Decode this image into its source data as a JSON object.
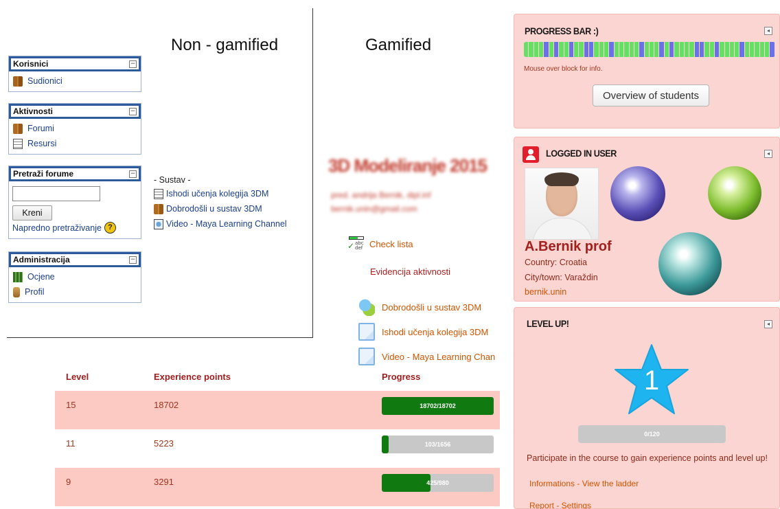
{
  "headings": {
    "non_gamified": "Non - gamified",
    "gamified": "Gamified"
  },
  "nongamified": {
    "blocks": [
      {
        "title": "Korisnici",
        "items": [
          {
            "label": "Sudionici",
            "icon": "people-icon"
          }
        ]
      },
      {
        "title": "Aktivnosti",
        "items": [
          {
            "label": "Forumi",
            "icon": "forum-icon"
          },
          {
            "label": "Resursi",
            "icon": "document-icon"
          }
        ]
      },
      {
        "title": "Pretraži forume",
        "search_value": "",
        "button_label": "Kreni",
        "advanced_link": "Napredno pretraživanje"
      },
      {
        "title": "Administracija",
        "items": [
          {
            "label": "Ocjene",
            "icon": "grades-icon"
          },
          {
            "label": "Profil",
            "icon": "profile-icon"
          }
        ]
      }
    ],
    "toggle_symbol": "−",
    "help_symbol": "?",
    "sustav": {
      "title": "- Sustav -",
      "items": [
        {
          "label": "Ishodi učenja kolegija 3DM",
          "icon": "document-icon"
        },
        {
          "label": "Dobrodošli u sustav 3DM",
          "icon": "forum-icon"
        },
        {
          "label": "Video - Maya Learning Channel",
          "icon": "video-icon"
        }
      ]
    }
  },
  "gamified": {
    "course_title": "3D Modeliranje 2015",
    "course_teacher": "pred. andrija Bernik, dipl.inf",
    "course_email": "bernik.unin@gmail.com",
    "checklist_label": "Check lista",
    "checklist_icon_text": "abc def",
    "activity_label": "Evidencija aktivnosti",
    "links": [
      {
        "label": "Dobrodošli u sustav 3DM",
        "icon": "forum-icon"
      },
      {
        "label": "Ishodi učenja kolegija 3DM",
        "icon": "document-icon"
      },
      {
        "label": "Video - Maya Learning Chan",
        "icon": "document-icon"
      }
    ]
  },
  "ladder": {
    "headers": {
      "level": "Level",
      "xp": "Experience points",
      "progress": "Progress"
    },
    "rows": [
      {
        "level": "15",
        "xp": "18702",
        "progress_label": "18702/18702",
        "progress_fraction": 1.0,
        "highlight": true
      },
      {
        "level": "11",
        "xp": "5223",
        "progress_label": "103/1656",
        "progress_fraction": 0.062,
        "highlight": false
      },
      {
        "level": "9",
        "xp": "3291",
        "progress_label": "425/980",
        "progress_fraction": 0.434,
        "highlight": true
      }
    ]
  },
  "progress_block": {
    "title": "PROGRESS BAR :)",
    "segments": [
      "green",
      "green",
      "green",
      "green",
      "blue",
      "green",
      "blue",
      "green",
      "green",
      "blue",
      "green",
      "green",
      "blue",
      "blue",
      "green",
      "green",
      "green",
      "blue",
      "green",
      "green",
      "green",
      "green",
      "green",
      "blue",
      "green",
      "green",
      "green",
      "blue",
      "green",
      "blue",
      "green",
      "green",
      "green",
      "green",
      "blue",
      "blue",
      "green",
      "green",
      "blue",
      "green",
      "green",
      "green",
      "green",
      "blue",
      "green",
      "green",
      "green",
      "green",
      "green",
      "blue"
    ],
    "note": "Mouse over block for info.",
    "button_label": "Overview of students"
  },
  "logged_user": {
    "title": "LOGGED IN USER",
    "name": "A.Bernik prof",
    "country": "Country: Croatia",
    "city": "City/town: Varaždin",
    "link": "bernik.unin"
  },
  "level_up": {
    "title": "LEVEL UP!",
    "level": "1",
    "progress_label": "0/120",
    "note": "Participate in the course to gain experience points and level up!",
    "links_row1": "Informations - View the ladder",
    "links_row2": "Report - Settings"
  },
  "colors": {
    "panel_bg": "#fbd5d2",
    "accent_red": "#a3201e",
    "link_orange": "#d35400",
    "bar_green": "#65df64",
    "bar_blue": "#6a70e6",
    "star_blue": "#1eb4f0"
  }
}
